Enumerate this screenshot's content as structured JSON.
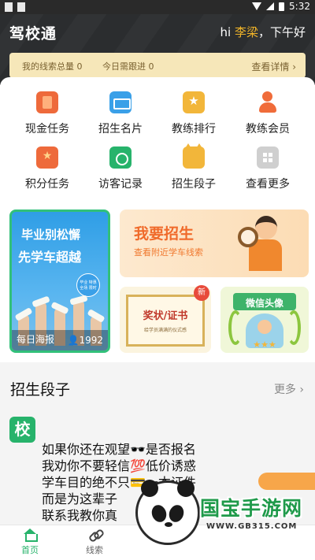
{
  "status_bar": {
    "time": "5:32"
  },
  "header": {
    "app_title": "驾校通",
    "greeting_prefix": "hi ",
    "user_name": "李梁",
    "greeting_suffix": "，下午好",
    "lead_total": "我的线索总量 0",
    "lead_today": "今日需跟进 0",
    "detail_link": "查看详情 ›"
  },
  "grid": [
    {
      "label": "现金任务",
      "icon": "cash-task-icon"
    },
    {
      "label": "招生名片",
      "icon": "business-card-icon"
    },
    {
      "label": "教练排行",
      "icon": "trophy-icon"
    },
    {
      "label": "教练会员",
      "icon": "coach-member-icon"
    },
    {
      "label": "积分任务",
      "icon": "points-task-icon"
    },
    {
      "label": "访客记录",
      "icon": "visitor-record-icon"
    },
    {
      "label": "招生段子",
      "icon": "fox-joke-icon"
    },
    {
      "label": "查看更多",
      "icon": "more-grid-icon"
    }
  ],
  "banners": {
    "poster": {
      "line1": "毕业别松懈",
      "line2": "先学车超越",
      "badge": "毕业 特惠 全场 限时",
      "daily": "每日海报",
      "count": "👤1992"
    },
    "recruit": {
      "title": "我要招生",
      "subtitle": "查看附近学车线索"
    },
    "certificate": {
      "title": "奖状/证书",
      "subtitle": "给学员满满的仪式感",
      "new_tag": "新"
    },
    "avatar": {
      "title": "微信头像",
      "stars": "★★★"
    }
  },
  "section": {
    "title": "招生段子",
    "more": "更多 ›"
  },
  "post": {
    "logo": "校",
    "lines": [
      "如果你还在观望🕶️是否报名",
      "我劝你不要轻信💯低价诱惑",
      "学车目的绝不只💳一本证件",
      "而是为这辈子",
      "联系我教你真"
    ]
  },
  "tabbar": [
    {
      "label": "首页",
      "active": true
    },
    {
      "label": "线索",
      "active": false
    }
  ],
  "watermark": {
    "text": "国宝手游网",
    "url": "WWW.GB315.COM"
  },
  "colors": {
    "brand_green": "#27b36b",
    "header_dark": "#2b2d2f",
    "lead_bar": "#f6e7b9",
    "accent_orange": "#f06a2a"
  }
}
